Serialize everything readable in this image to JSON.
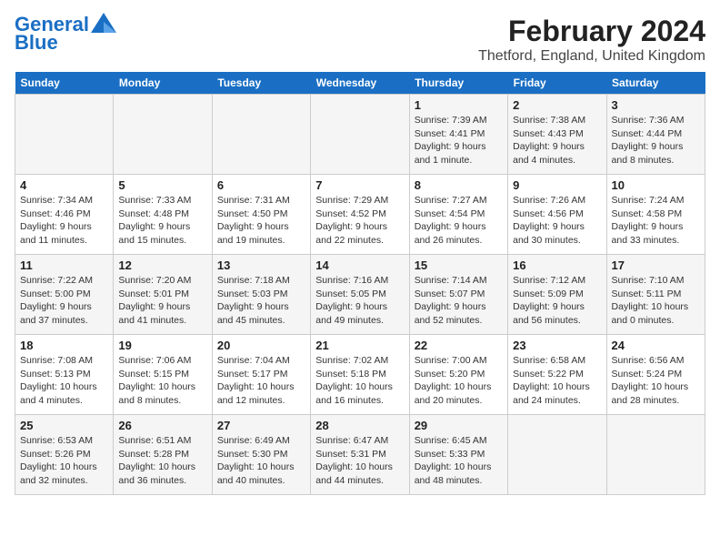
{
  "header": {
    "logo": {
      "line1": "General",
      "line2": "Blue"
    },
    "title": "February 2024",
    "subtitle": "Thetford, England, United Kingdom"
  },
  "weekdays": [
    "Sunday",
    "Monday",
    "Tuesday",
    "Wednesday",
    "Thursday",
    "Friday",
    "Saturday"
  ],
  "weeks": [
    [
      {
        "day": "",
        "info": ""
      },
      {
        "day": "",
        "info": ""
      },
      {
        "day": "",
        "info": ""
      },
      {
        "day": "",
        "info": ""
      },
      {
        "day": "1",
        "info": "Sunrise: 7:39 AM\nSunset: 4:41 PM\nDaylight: 9 hours\nand 1 minute."
      },
      {
        "day": "2",
        "info": "Sunrise: 7:38 AM\nSunset: 4:43 PM\nDaylight: 9 hours\nand 4 minutes."
      },
      {
        "day": "3",
        "info": "Sunrise: 7:36 AM\nSunset: 4:44 PM\nDaylight: 9 hours\nand 8 minutes."
      }
    ],
    [
      {
        "day": "4",
        "info": "Sunrise: 7:34 AM\nSunset: 4:46 PM\nDaylight: 9 hours\nand 11 minutes."
      },
      {
        "day": "5",
        "info": "Sunrise: 7:33 AM\nSunset: 4:48 PM\nDaylight: 9 hours\nand 15 minutes."
      },
      {
        "day": "6",
        "info": "Sunrise: 7:31 AM\nSunset: 4:50 PM\nDaylight: 9 hours\nand 19 minutes."
      },
      {
        "day": "7",
        "info": "Sunrise: 7:29 AM\nSunset: 4:52 PM\nDaylight: 9 hours\nand 22 minutes."
      },
      {
        "day": "8",
        "info": "Sunrise: 7:27 AM\nSunset: 4:54 PM\nDaylight: 9 hours\nand 26 minutes."
      },
      {
        "day": "9",
        "info": "Sunrise: 7:26 AM\nSunset: 4:56 PM\nDaylight: 9 hours\nand 30 minutes."
      },
      {
        "day": "10",
        "info": "Sunrise: 7:24 AM\nSunset: 4:58 PM\nDaylight: 9 hours\nand 33 minutes."
      }
    ],
    [
      {
        "day": "11",
        "info": "Sunrise: 7:22 AM\nSunset: 5:00 PM\nDaylight: 9 hours\nand 37 minutes."
      },
      {
        "day": "12",
        "info": "Sunrise: 7:20 AM\nSunset: 5:01 PM\nDaylight: 9 hours\nand 41 minutes."
      },
      {
        "day": "13",
        "info": "Sunrise: 7:18 AM\nSunset: 5:03 PM\nDaylight: 9 hours\nand 45 minutes."
      },
      {
        "day": "14",
        "info": "Sunrise: 7:16 AM\nSunset: 5:05 PM\nDaylight: 9 hours\nand 49 minutes."
      },
      {
        "day": "15",
        "info": "Sunrise: 7:14 AM\nSunset: 5:07 PM\nDaylight: 9 hours\nand 52 minutes."
      },
      {
        "day": "16",
        "info": "Sunrise: 7:12 AM\nSunset: 5:09 PM\nDaylight: 9 hours\nand 56 minutes."
      },
      {
        "day": "17",
        "info": "Sunrise: 7:10 AM\nSunset: 5:11 PM\nDaylight: 10 hours\nand 0 minutes."
      }
    ],
    [
      {
        "day": "18",
        "info": "Sunrise: 7:08 AM\nSunset: 5:13 PM\nDaylight: 10 hours\nand 4 minutes."
      },
      {
        "day": "19",
        "info": "Sunrise: 7:06 AM\nSunset: 5:15 PM\nDaylight: 10 hours\nand 8 minutes."
      },
      {
        "day": "20",
        "info": "Sunrise: 7:04 AM\nSunset: 5:17 PM\nDaylight: 10 hours\nand 12 minutes."
      },
      {
        "day": "21",
        "info": "Sunrise: 7:02 AM\nSunset: 5:18 PM\nDaylight: 10 hours\nand 16 minutes."
      },
      {
        "day": "22",
        "info": "Sunrise: 7:00 AM\nSunset: 5:20 PM\nDaylight: 10 hours\nand 20 minutes."
      },
      {
        "day": "23",
        "info": "Sunrise: 6:58 AM\nSunset: 5:22 PM\nDaylight: 10 hours\nand 24 minutes."
      },
      {
        "day": "24",
        "info": "Sunrise: 6:56 AM\nSunset: 5:24 PM\nDaylight: 10 hours\nand 28 minutes."
      }
    ],
    [
      {
        "day": "25",
        "info": "Sunrise: 6:53 AM\nSunset: 5:26 PM\nDaylight: 10 hours\nand 32 minutes."
      },
      {
        "day": "26",
        "info": "Sunrise: 6:51 AM\nSunset: 5:28 PM\nDaylight: 10 hours\nand 36 minutes."
      },
      {
        "day": "27",
        "info": "Sunrise: 6:49 AM\nSunset: 5:30 PM\nDaylight: 10 hours\nand 40 minutes."
      },
      {
        "day": "28",
        "info": "Sunrise: 6:47 AM\nSunset: 5:31 PM\nDaylight: 10 hours\nand 44 minutes."
      },
      {
        "day": "29",
        "info": "Sunrise: 6:45 AM\nSunset: 5:33 PM\nDaylight: 10 hours\nand 48 minutes."
      },
      {
        "day": "",
        "info": ""
      },
      {
        "day": "",
        "info": ""
      }
    ]
  ]
}
